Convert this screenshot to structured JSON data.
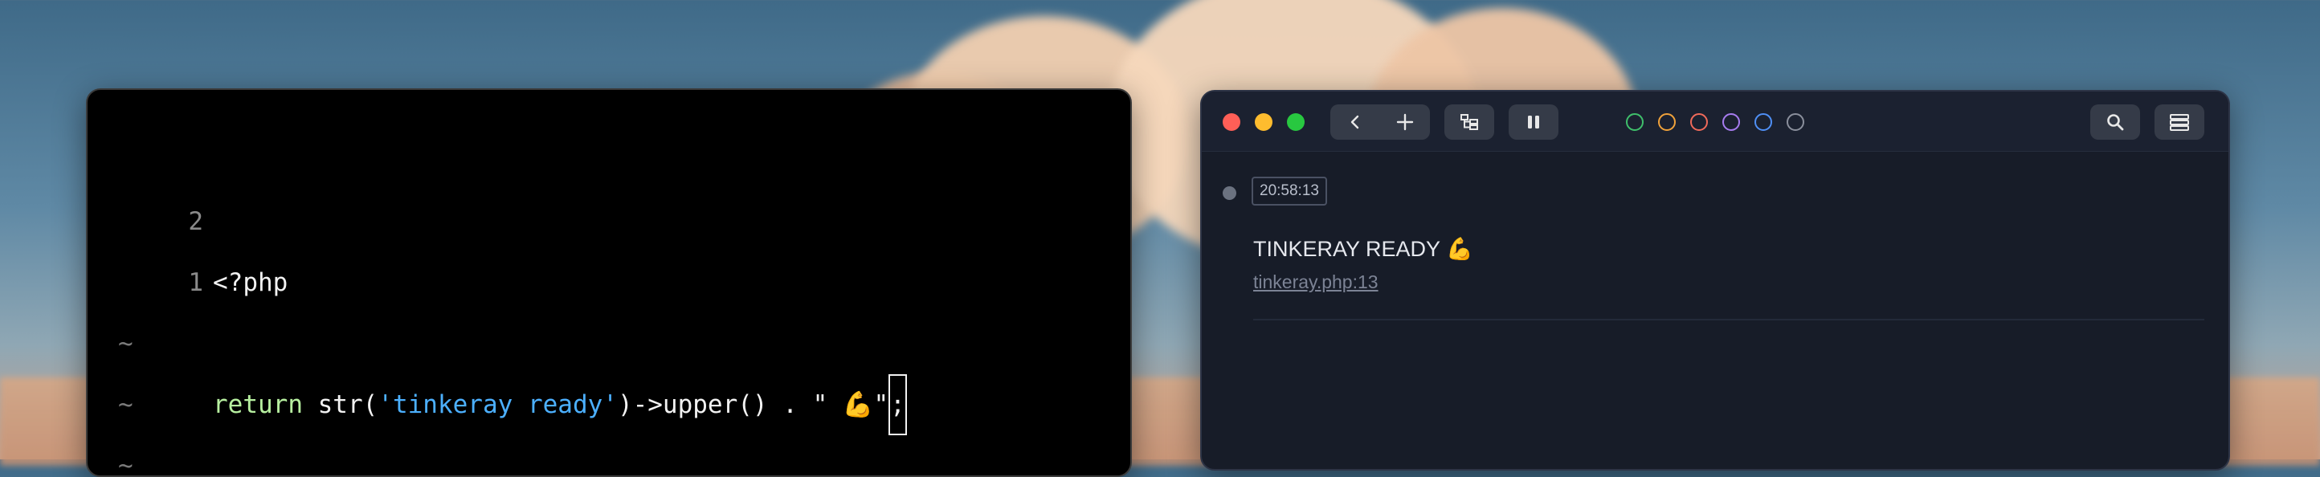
{
  "editor": {
    "lines": [
      {
        "gutter": "2",
        "code": "<?php"
      },
      {
        "gutter": "1",
        "code": ""
      },
      {
        "gutter": "",
        "keyword": "return",
        "pre": " str(",
        "string": "'tinkeray ready'",
        "post": ")->upper() . \" 💪\"",
        "cursor_char": ";"
      }
    ],
    "tildes": [
      "~",
      "~",
      "~"
    ]
  },
  "tinkeray": {
    "timestamp": "20:58:13",
    "message": "TINKERAY READY 💪",
    "source_link": "tinkeray.php:13",
    "icons": {
      "back": "chevron-left-icon",
      "add": "plus-icon",
      "tree": "tree-icon",
      "pause": "pause-icon",
      "search": "search-icon",
      "stack": "stack-icon"
    },
    "color_filters": [
      "#3fbf6b",
      "#f0a23b",
      "#f06a5a",
      "#a77cf0",
      "#4f8ff5",
      "#8a8f9c"
    ],
    "traffic_lights": [
      "#ff5f57",
      "#febc2e",
      "#28c840"
    ]
  }
}
